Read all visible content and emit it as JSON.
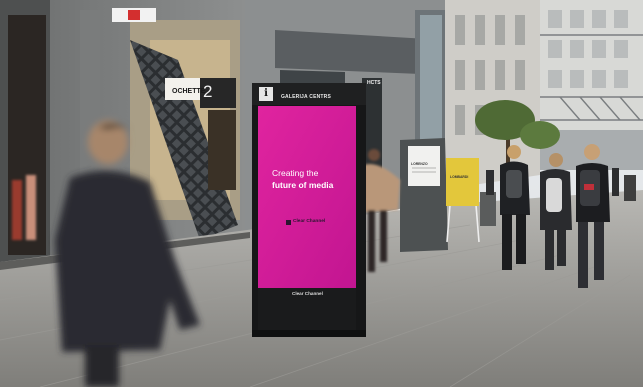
{
  "photo": {
    "kiosk": {
      "header": "GALERIJA CENTRS",
      "info_icon": "info-icon",
      "screen_color": "#d41a9c",
      "headline_line1": "Creating the",
      "headline_line2": "future of media",
      "screen_logo": "Clear Channel",
      "base_logo": "Clear Channel"
    },
    "storefront_signs": {
      "left_sign": "OCHETTE",
      "left_sign_number": "2",
      "right_sign": "HCTS"
    },
    "sandwich_boards": {
      "grey_board": "LORENZO",
      "yellow_board": "LOMBARDI"
    }
  }
}
